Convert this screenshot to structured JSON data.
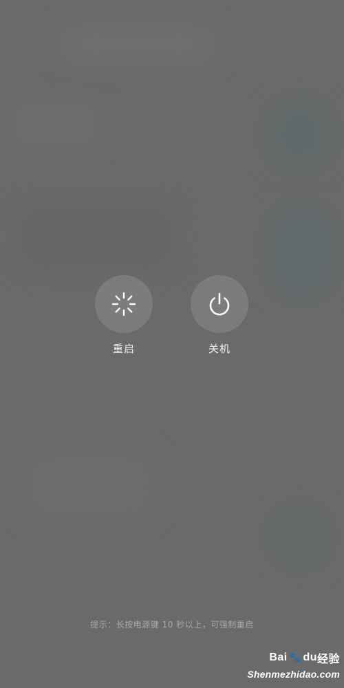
{
  "power_menu": {
    "restart": {
      "label": "重启",
      "icon": "restart-spinner-icon"
    },
    "power_off": {
      "label": "关机",
      "icon": "power-icon"
    }
  },
  "hint": "提示：长按电源键 10 秒以上，可强制重启",
  "watermark": {
    "brand_left": "Bai",
    "brand_mid": "du",
    "brand_right": "经验",
    "site": "Shenmezhidao.com"
  },
  "colors": {
    "background": "#6a6a6a",
    "button_fill": "#7c7c7c",
    "label_text": "#f2f2f2",
    "hint_text": "#a9a9a9"
  }
}
